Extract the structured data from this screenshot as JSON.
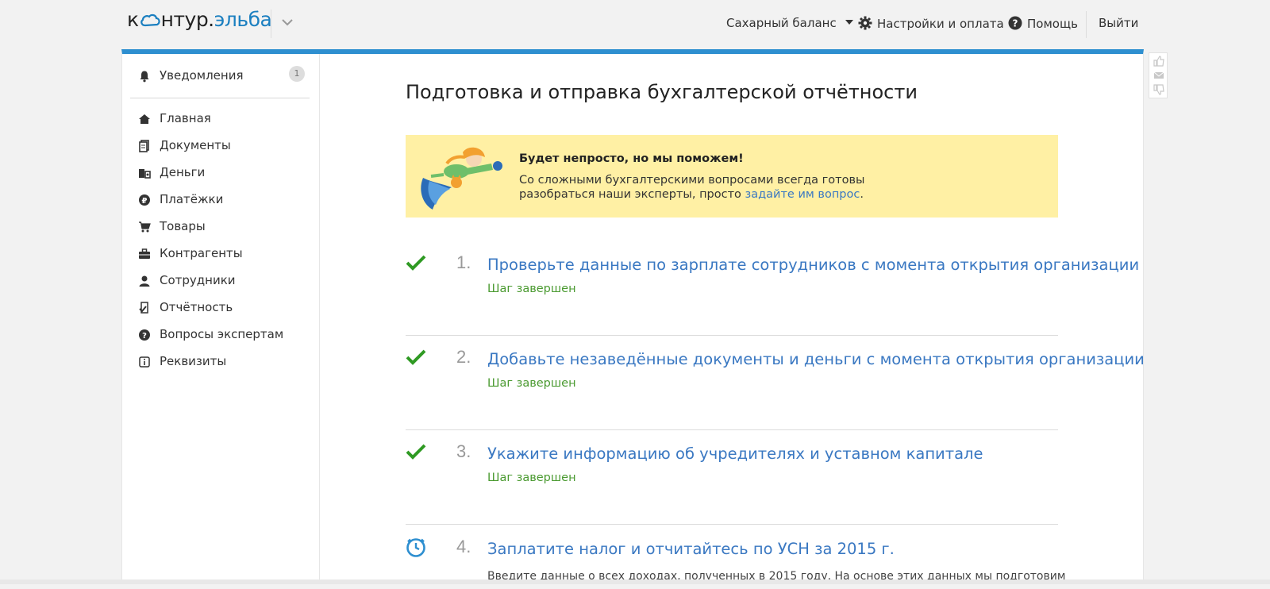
{
  "header": {
    "logo_left": "к",
    "logo_mid": "нтур.",
    "logo_right": "эльба",
    "org_name": "Сахарный баланс",
    "settings": "Настройки и оплата",
    "help": "Помощь",
    "logout": "Выйти"
  },
  "sidebar": {
    "notifications": {
      "label": "Уведомления",
      "count": "1"
    },
    "items": [
      {
        "label": "Главная",
        "icon": "home-icon"
      },
      {
        "label": "Документы",
        "icon": "documents-icon"
      },
      {
        "label": "Деньги",
        "icon": "money-icon"
      },
      {
        "label": "Платёжки",
        "icon": "payments-icon"
      },
      {
        "label": "Товары",
        "icon": "cart-icon"
      },
      {
        "label": "Контрагенты",
        "icon": "briefcase-icon"
      },
      {
        "label": "Сотрудники",
        "icon": "person-icon"
      },
      {
        "label": "Отчётность",
        "icon": "report-icon"
      },
      {
        "label": "Вопросы экспертам",
        "icon": "question-icon"
      },
      {
        "label": "Реквизиты",
        "icon": "info-icon"
      }
    ]
  },
  "main": {
    "title": "Подготовка и отправка бухгалтерской отчётности",
    "promo": {
      "title": "Будет непросто, но мы поможем!",
      "text_1": "Со сложными бухгалтерскими вопросами всегда готовы разобраться наши эксперты, просто ",
      "link": "задайте им вопрос",
      "text_2": "."
    },
    "steps": [
      {
        "num": "1.",
        "title": "Проверьте данные по зарплате сотрудников с момента открытия организации",
        "status": "Шаг завершен",
        "state": "done"
      },
      {
        "num": "2.",
        "title": "Добавьте незаведённые документы и деньги с момента открытия организации",
        "status": "Шаг завершен",
        "state": "done"
      },
      {
        "num": "3.",
        "title": "Укажите информацию об учредителях и уставном капитале",
        "status": "Шаг завершен",
        "state": "done"
      },
      {
        "num": "4.",
        "title": "Заплатите налог и отчитайтесь по УСН за 2015 г.",
        "status": "Введите данные о всех доходах, полученных в 2015 году. На основе этих данных мы подготовим",
        "state": "pending"
      }
    ]
  },
  "colors": {
    "accent": "#2e8fd0",
    "link": "#3a78c2",
    "success": "#4a9a30",
    "promo_bg": "#fff0a4"
  }
}
